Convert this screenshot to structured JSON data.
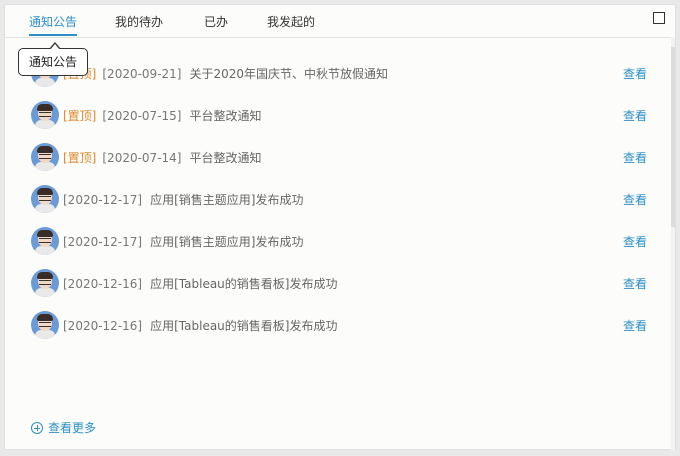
{
  "tabs": [
    {
      "label": "通知公告",
      "active": true
    },
    {
      "label": "我的待办",
      "active": false
    },
    {
      "label": "已办",
      "active": false
    },
    {
      "label": "我发起的",
      "active": false
    }
  ],
  "tooltip": {
    "text": "通知公告"
  },
  "view_label": "查看",
  "more_label": "查看更多",
  "colors": {
    "accent": "#2b8fc9",
    "pinned": "#e08a2a"
  },
  "items": [
    {
      "pin": "[置顶]",
      "date": "[2020-09-21]",
      "title": "关于2020年国庆节、中秋节放假通知"
    },
    {
      "pin": "[置顶]",
      "date": "[2020-07-15]",
      "title": "平台整改通知"
    },
    {
      "pin": "[置顶]",
      "date": "[2020-07-14]",
      "title": "平台整改通知"
    },
    {
      "pin": "",
      "date": "[2020-12-17]",
      "title": "应用[销售主题应用]发布成功"
    },
    {
      "pin": "",
      "date": "[2020-12-17]",
      "title": "应用[销售主题应用]发布成功"
    },
    {
      "pin": "",
      "date": "[2020-12-16]",
      "title": "应用[Tableau的销售看板]发布成功"
    },
    {
      "pin": "",
      "date": "[2020-12-16]",
      "title": "应用[Tableau的销售看板]发布成功"
    }
  ]
}
